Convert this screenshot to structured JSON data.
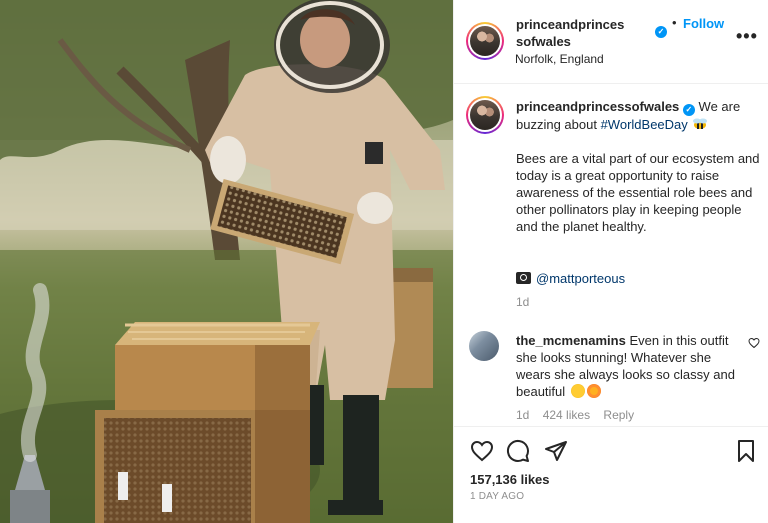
{
  "photo": {
    "description_icon": "beekeeper-photo"
  },
  "header": {
    "username": "princeandprincessofwales",
    "verified_icon": "verified-badge-icon",
    "separator": "•",
    "follow_label": "Follow",
    "location": "Norfolk, England",
    "more_icon": "more-options-icon"
  },
  "caption": {
    "username": "princeandprincessofwales",
    "text_before_tag": "We are buzzing about ",
    "hashtag": "#WorldBeeDay",
    "paragraph": "Bees are a vital part of our ecosystem and today is a great opportunity to raise awareness of the essential role bees and other pollinators play in keeping people and the planet healthy.",
    "credit_handle": "@mattporteous",
    "time": "1d"
  },
  "comment": {
    "username": "the_mcmenamins",
    "text": "Even in this outfit she looks stunning! Whatever she wears she always looks so classy and beautiful",
    "time": "1d",
    "likes": "424 likes",
    "reply_label": "Reply"
  },
  "actions": {
    "likes_count": "157,136 likes",
    "post_time": "1 DAY AGO"
  },
  "colors": {
    "accent": "#0095f6",
    "link": "#00376b",
    "muted": "#8e8e8e"
  }
}
